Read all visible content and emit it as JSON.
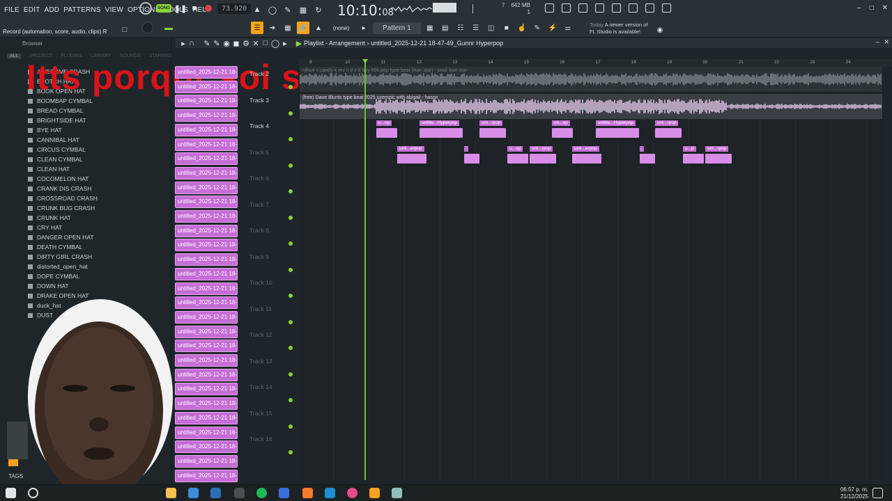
{
  "menu": [
    "FILE",
    "EDIT",
    "ADD",
    "PATTERNS",
    "VIEW",
    "OPTIONS",
    "TOOLS",
    "HELP"
  ],
  "transport": {
    "song_label": "SONG",
    "tempo": "73.920"
  },
  "clock": {
    "main": "10:10",
    "sub": "08"
  },
  "cpu": {
    "memory": "642 MB",
    "poly": "1",
    "cpu_num": "7"
  },
  "hint_text": "Record  (automation, score, audio, clips)",
  "hint_key": "R",
  "pattern": {
    "none_label": "(none)",
    "name": "Pattern 1"
  },
  "news": {
    "line1_prefix": "Today",
    "line1": "A newer version of",
    "line2": "FL Studio is available!"
  },
  "browser": {
    "title": "Browser",
    "tabs": [
      "ALL",
      "PROJECT",
      "PLUGINS",
      "LIBRARY",
      "SOUNDS",
      "STARRED"
    ],
    "items": [
      "AWESOME CRASH",
      "BEOTCH HAT",
      "BOOK OPEN HAT",
      "BOOMBAP CYMBAL",
      "BREAD CYMBAL",
      "BRIGHTSIDE HAT",
      "BYE HAT",
      "CANNIBAL HAT",
      "CIRCUS CYMBAL",
      "CLEAN CYMBAL",
      "CLEAN HAT",
      "COCOMELON HAT",
      "CRANK DIS CRASH",
      "CROSSROAD CRASH",
      "CRUNK BUG CRASH",
      "CRUNK HAT",
      "CRY HAT",
      "DANGER OPEN HAT",
      "DEATH CYMBAL",
      "DIRTY GIRL CRASH",
      "distorted_open_hat",
      "DOPE CYMBAL",
      "DOWN HAT",
      "DRAKE OPEN HAT",
      "duck_hat",
      "DUST"
    ],
    "tags_label": "TAGS"
  },
  "overlay_caption": "Itts porqur soi siego",
  "clip_list_item": "untitled_2025-12-21 18-",
  "playlist": {
    "title": "Playlist - Arrangement",
    "project": "untitled_2025-12-21 18-47-49_Gunnr Hyperpop"
  },
  "ruler": [
    "9",
    "10",
    "11",
    "12",
    "13",
    "14",
    "15",
    "16",
    "17",
    "18",
    "19",
    "20",
    "21",
    "22",
    "23",
    "24"
  ],
  "tracks": [
    "Track 2",
    "Track 3",
    "Track 4",
    "Track 5",
    "Track 6",
    "Track 7",
    "Track 8",
    "Track 9",
    "Track 10",
    "Track 11",
    "Track 12",
    "Track 13",
    "Track 14",
    "Track 15",
    "Track 16"
  ],
  "strips": {
    "track1": "ryhue x candy x rev n d e ti boy 80s pop type beat (ikari star) - prod ikari star",
    "track2": "(free) Dave Blunts type beat 2025 ozempic with abigail - hason"
  },
  "clips_track3": [
    "u...op",
    "untitle...Hyperpop",
    "unt...rpop",
    "un...op",
    "untitle...Hyperpop",
    "unt...rpop"
  ],
  "clips_track4": [
    "unti...erpop",
    "",
    "u...op",
    "unt...rpop",
    "unti...erpop",
    "",
    "u...p",
    "unt...rpop"
  ],
  "tray": {
    "time": "06:57 p. m.",
    "date": "21/12/2025"
  },
  "colors": {
    "clip": "#c66dd6",
    "playhead": "#6ac436",
    "accent": "#f6a21c",
    "caption": "#d8141a"
  }
}
